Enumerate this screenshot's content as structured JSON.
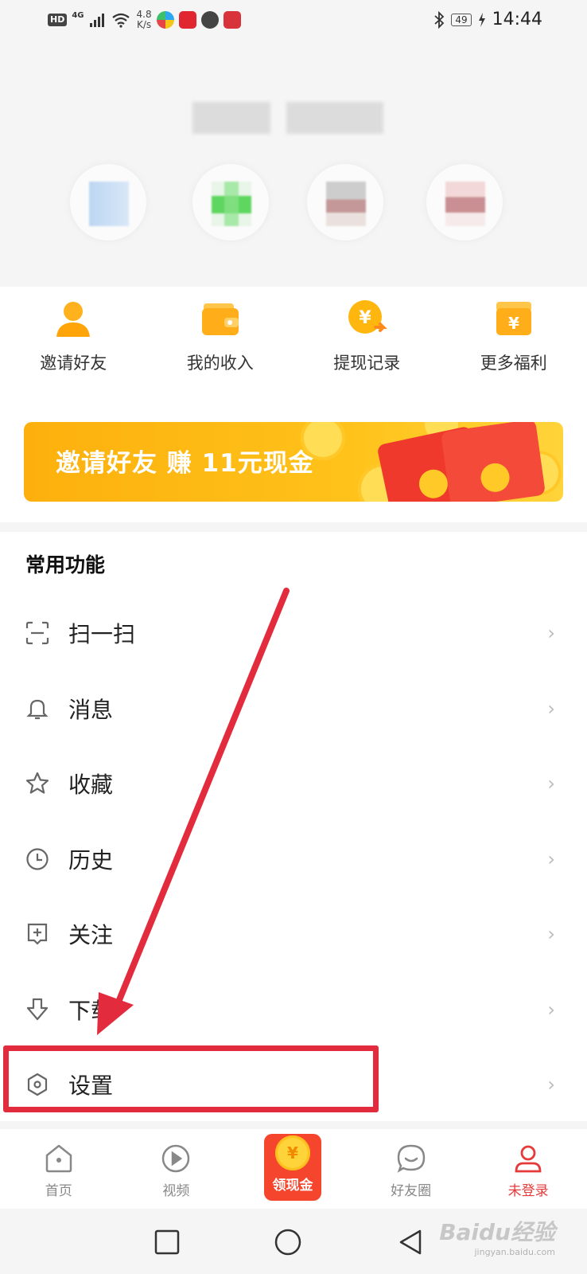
{
  "status_bar": {
    "hd": "HD",
    "network": "4G",
    "speed_value": "4.8",
    "speed_unit": "K/s",
    "battery": "49",
    "time": "14:44"
  },
  "quick_actions": [
    {
      "label": "邀请好友",
      "icon": "person-icon"
    },
    {
      "label": "我的收入",
      "icon": "wallet-icon"
    },
    {
      "label": "提现记录",
      "icon": "yuan-coin-icon"
    },
    {
      "label": "更多福利",
      "icon": "gift-box-icon"
    }
  ],
  "banner": {
    "text_prefix": "邀请好友",
    "text_mid": " 赚 ",
    "text_amount": "11",
    "text_suffix": "元现金"
  },
  "common": {
    "title": "常用功能",
    "items": [
      {
        "label": "扫一扫",
        "icon": "scan-icon"
      },
      {
        "label": "消息",
        "icon": "bell-icon"
      },
      {
        "label": "收藏",
        "icon": "star-icon"
      },
      {
        "label": "历史",
        "icon": "clock-icon"
      },
      {
        "label": "关注",
        "icon": "follow-plus-icon"
      },
      {
        "label": "下载",
        "icon": "download-icon"
      },
      {
        "label": "设置",
        "icon": "settings-hexagon-icon"
      }
    ],
    "chevron": "›"
  },
  "tabs": [
    {
      "label": "首页",
      "icon": "home-icon"
    },
    {
      "label": "视频",
      "icon": "play-icon"
    },
    {
      "label": "领现金",
      "icon": "yuan-coin-icon"
    },
    {
      "label": "好友圈",
      "icon": "chat-bubble-icon"
    },
    {
      "label": "未登录",
      "icon": "user-icon"
    }
  ],
  "cash_symbol": "¥",
  "watermark": {
    "main": "Baidu经验",
    "sub": "jingyan.baidu.com"
  },
  "colors": {
    "accent": "#e63a3a",
    "banner": "#ffc21a",
    "annotation": "#e32b3e"
  }
}
